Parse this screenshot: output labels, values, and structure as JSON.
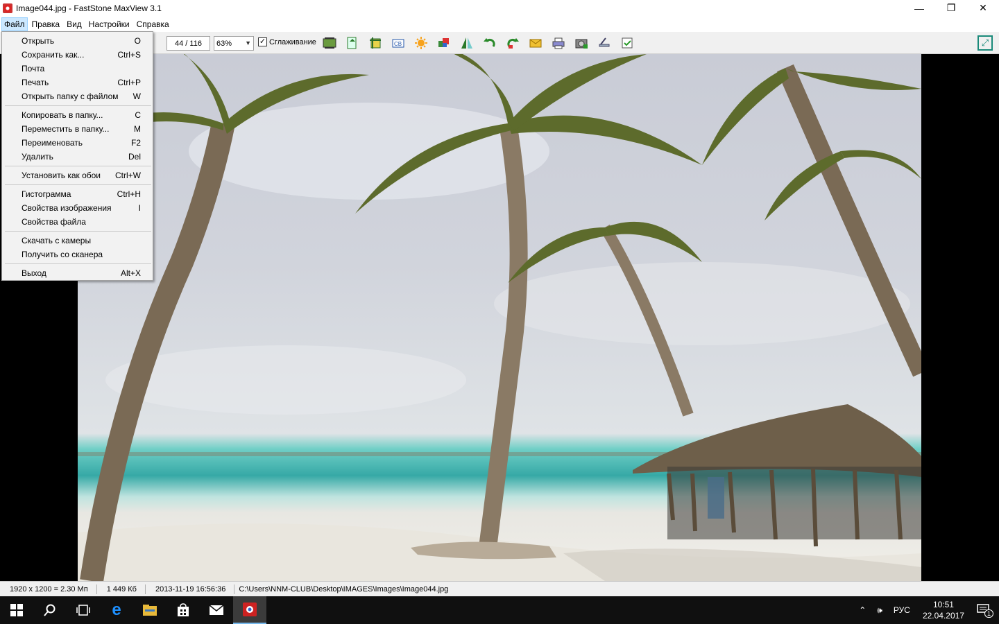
{
  "window": {
    "title": "Image044.jpg - FastStone MaxView 3.1",
    "minimize": "—",
    "restore": "❐",
    "close": "✕"
  },
  "menubar": {
    "items": [
      "Файл",
      "Правка",
      "Вид",
      "Настройки",
      "Справка"
    ]
  },
  "toolbar": {
    "page_counter": "44 / 116",
    "zoom": "63%",
    "smoothing_label": "Сглаживание",
    "smoothing_checked": true,
    "icons": [
      "slideshow-icon",
      "open-icon",
      "crop-icon",
      "resize-icon",
      "brightness-icon",
      "color-icon",
      "flip-icon",
      "rotate-left-icon",
      "rotate-right-icon",
      "email-icon",
      "print-icon",
      "camera-icon",
      "scanner-icon",
      "settings-icon"
    ],
    "fit_icon": "fullscreen-icon"
  },
  "file_menu": {
    "groups": [
      [
        {
          "label": "Открыть",
          "shortcut": "O"
        },
        {
          "label": "Сохранить как...",
          "shortcut": "Ctrl+S"
        },
        {
          "label": "Почта",
          "shortcut": ""
        },
        {
          "label": "Печать",
          "shortcut": "Ctrl+P"
        },
        {
          "label": "Открыть папку с файлом",
          "shortcut": "W"
        }
      ],
      [
        {
          "label": "Копировать в папку...",
          "shortcut": "C"
        },
        {
          "label": "Переместить в папку...",
          "shortcut": "M"
        },
        {
          "label": "Переименовать",
          "shortcut": "F2"
        },
        {
          "label": "Удалить",
          "shortcut": "Del"
        }
      ],
      [
        {
          "label": "Установить как обои",
          "shortcut": "Ctrl+W"
        }
      ],
      [
        {
          "label": "Гистограмма",
          "shortcut": "Ctrl+H"
        },
        {
          "label": "Свойства изображения",
          "shortcut": "I"
        },
        {
          "label": "Свойства файла",
          "shortcut": ""
        }
      ],
      [
        {
          "label": "Скачать с камеры",
          "shortcut": ""
        },
        {
          "label": "Получить со сканера",
          "shortcut": ""
        }
      ],
      [
        {
          "label": "Выход",
          "shortcut": "Alt+X"
        }
      ]
    ]
  },
  "statusbar": {
    "dimensions": "1920 x 1200 = 2.30 Мп",
    "filesize": "1 449 Кб",
    "datetime": "2013-11-19 16:56:36",
    "path": "C:\\Users\\NNM-CLUB\\Desktop\\IMAGES\\Images\\Image044.jpg"
  },
  "taskbar": {
    "apps": [
      "windows-start-icon",
      "search-icon",
      "task-view-icon",
      "edge-icon",
      "file-explorer-icon",
      "store-icon",
      "mail-icon",
      "faststone-icon"
    ],
    "lang": "РУС",
    "time": "10:51",
    "date": "22.04.2017",
    "notification_count": "1"
  }
}
